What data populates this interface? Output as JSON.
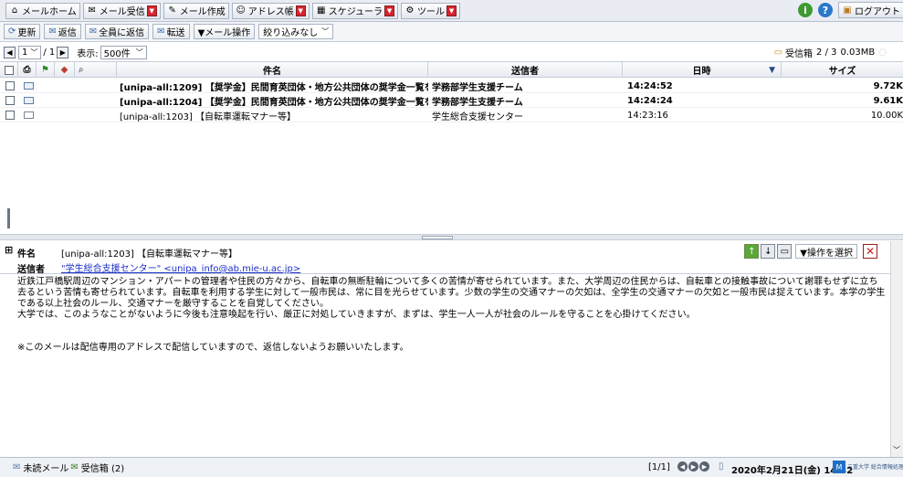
{
  "topbar": {
    "items": [
      {
        "label": "メールホーム",
        "icon": "home-icon",
        "dropdown": false
      },
      {
        "label": "メール受信",
        "icon": "mail-receive-icon",
        "dropdown": true
      },
      {
        "label": "メール作成",
        "icon": "mail-compose-icon",
        "dropdown": false
      },
      {
        "label": "アドレス帳",
        "icon": "address-book-icon",
        "dropdown": true
      },
      {
        "label": "スケジューラ",
        "icon": "calendar-icon",
        "dropdown": true
      },
      {
        "label": "ツール",
        "icon": "tools-icon",
        "dropdown": true
      }
    ],
    "logout_label": "ログアウト"
  },
  "toolbar": {
    "refresh": "更新",
    "reply": "返信",
    "reply_all": "全員に返信",
    "forward": "転送",
    "mail_ops": "▼メール操作",
    "filter": "絞り込みなし"
  },
  "pager": {
    "page_value": "1",
    "page_total": "/ 1",
    "display_label": "表示:",
    "display_value": "500件"
  },
  "folder": {
    "name": "受信箱",
    "count": "2 / 3",
    "size": "0.03MB"
  },
  "columns": {
    "subject": "件名",
    "sender": "送信者",
    "date": "日時",
    "size": "サイズ"
  },
  "messages": [
    {
      "subject": "[unipa-all:1209] 【奨学金】民間育英団体・地方公共団体の奨学金一覧を更新",
      "sender": "学務部学生支援チーム",
      "time": "14:24:52",
      "size": "9.72K",
      "unread": true
    },
    {
      "subject": "[unipa-all:1204] 【奨学金】民間育英団体・地方公共団体の奨学金一覧を更新",
      "sender": "学務部学生支援チーム",
      "time": "14:24:24",
      "size": "9.61K",
      "unread": true
    },
    {
      "subject": "[unipa-all:1203] 【自転車運転マナー等】",
      "sender": "学生総合支援センター",
      "time": "14:23:16",
      "size": "10.00K",
      "unread": false
    }
  ],
  "preview": {
    "subject_label": "件名",
    "subject": "[unipa-all:1203] 【自転車運転マナー等】",
    "sender_label": "送信者",
    "sender": "\"学生総合支援センター\" <unipa_info@ab.mie-u.ac.jp>",
    "action_select": "▼操作を選択",
    "body_lines": [
      "近鉄江戸橋駅周辺のマンション・アパートの管理者や住民の方々から、自転車の無断駐輪について多くの苦情が寄せられています。また、大学周辺の住民からは、自転車との接触事故について謝罪もせずに立ち去るという苦情も寄せられています。自転車を利用する学生に対して一般市民は、常に目を光らせています。少数の学生の交通マナーの欠如は、全学生の交通マナーの欠如と一般市民は捉えています。本学の学生である以上社会のルール、交通マナーを厳守することを自覚してください。",
      "大学では、このようなことがないように今後も注意喚起を行い、厳正に対処していきますが、まずは、学生一人一人が社会のルールを守ることを心掛けてください。",
      "",
      "",
      "※このメールは配信専用のアドレスで配信していますので、返信しないようお願いいたします。"
    ]
  },
  "statusbar": {
    "unread": "未読メール",
    "inbox": "受信箱 (2)",
    "page": "[1/1]",
    "datetime": "2020年2月21日(金) 14:32",
    "footer_logo_text": "三重大学 総合情報処理センター"
  },
  "colors": {
    "toolbar_bg": "#e9edf3",
    "accent_red": "#d6252c",
    "link": "#1d2fc7"
  }
}
